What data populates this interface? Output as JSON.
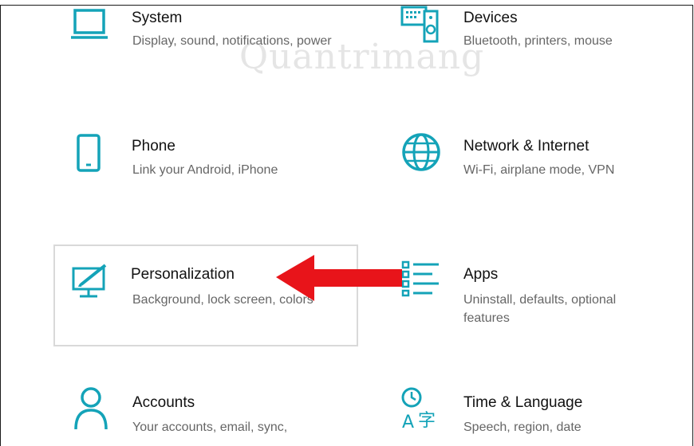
{
  "watermark": "Quantrimang",
  "accent_color": "#14a3b8",
  "arrow_color": "#e8141a",
  "tiles": [
    {
      "icon": "laptop-icon",
      "title": "System",
      "desc": "Display, sound, notifications, power"
    },
    {
      "icon": "devices-icon",
      "title": "Devices",
      "desc": "Bluetooth, printers, mouse"
    },
    {
      "icon": "phone-icon",
      "title": "Phone",
      "desc": "Link your Android, iPhone"
    },
    {
      "icon": "globe-icon",
      "title": "Network & Internet",
      "desc": "Wi-Fi, airplane mode, VPN"
    },
    {
      "icon": "personalization-icon",
      "title": "Personalization",
      "desc": "Background, lock screen, colors"
    },
    {
      "icon": "apps-icon",
      "title": "Apps",
      "desc": "Uninstall, defaults, optional features"
    },
    {
      "icon": "person-icon",
      "title": "Accounts",
      "desc": "Your accounts, email, sync,"
    },
    {
      "icon": "time-language-icon",
      "title": "Time & Language",
      "desc": "Speech, region, date"
    }
  ]
}
